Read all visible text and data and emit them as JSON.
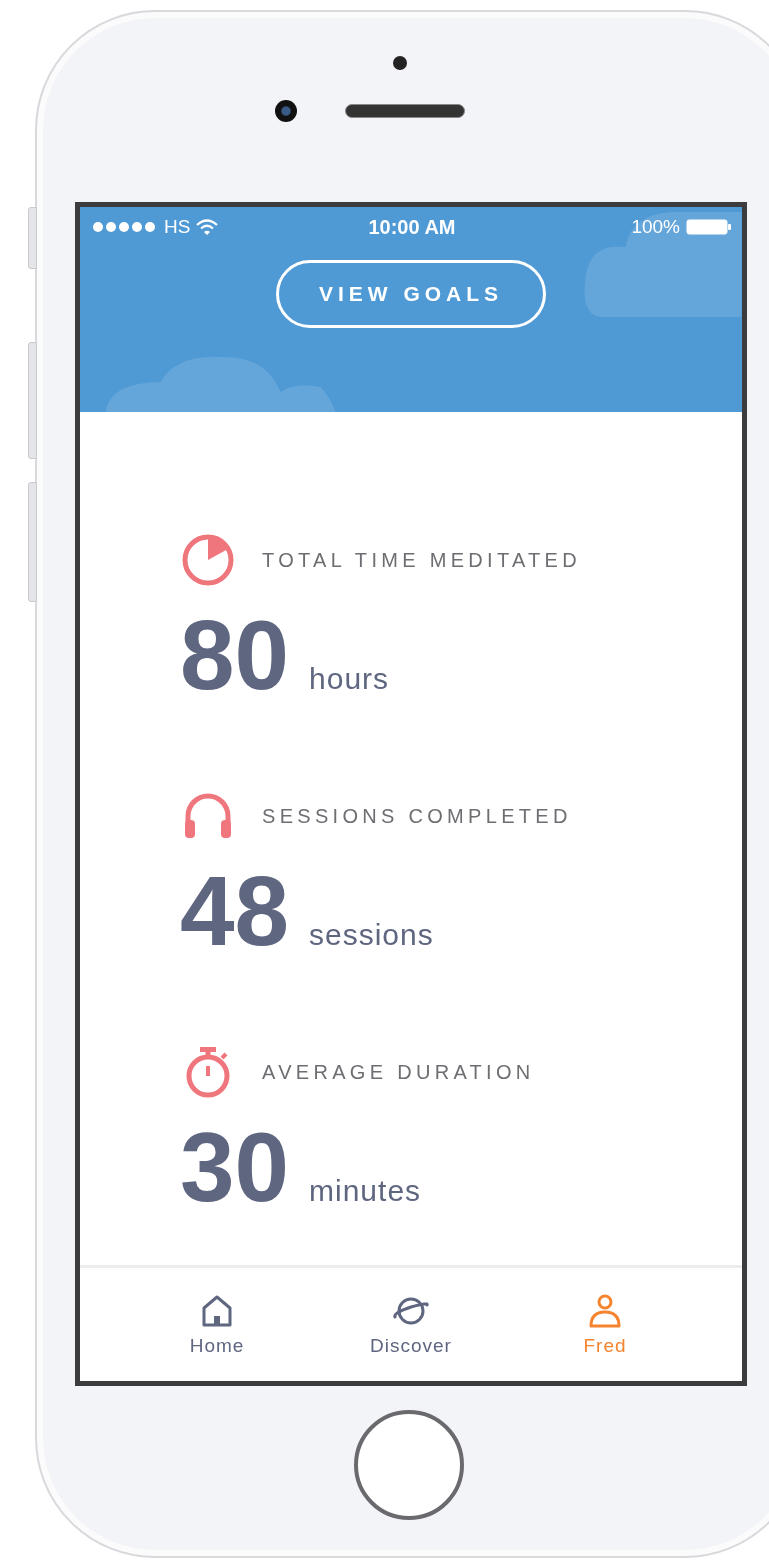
{
  "status_bar": {
    "carrier": "HS",
    "time": "10:00 AM",
    "battery": "100%"
  },
  "header": {
    "button": "VIEW GOALS"
  },
  "stats": [
    {
      "kind": "pie",
      "label": "TOTAL TIME MEDITATED",
      "value": "80",
      "unit": "hours"
    },
    {
      "kind": "headphones",
      "label": "SESSIONS COMPLETED",
      "value": "48",
      "unit": "sessions"
    },
    {
      "kind": "timer",
      "label": "AVERAGE DURATION",
      "value": "30",
      "unit": "minutes"
    }
  ],
  "tab_bar": [
    {
      "kind": "home",
      "label": "Home",
      "selected": false
    },
    {
      "kind": "planet",
      "label": "Discover",
      "selected": false
    },
    {
      "kind": "person",
      "label": "Fred",
      "selected": true
    }
  ]
}
